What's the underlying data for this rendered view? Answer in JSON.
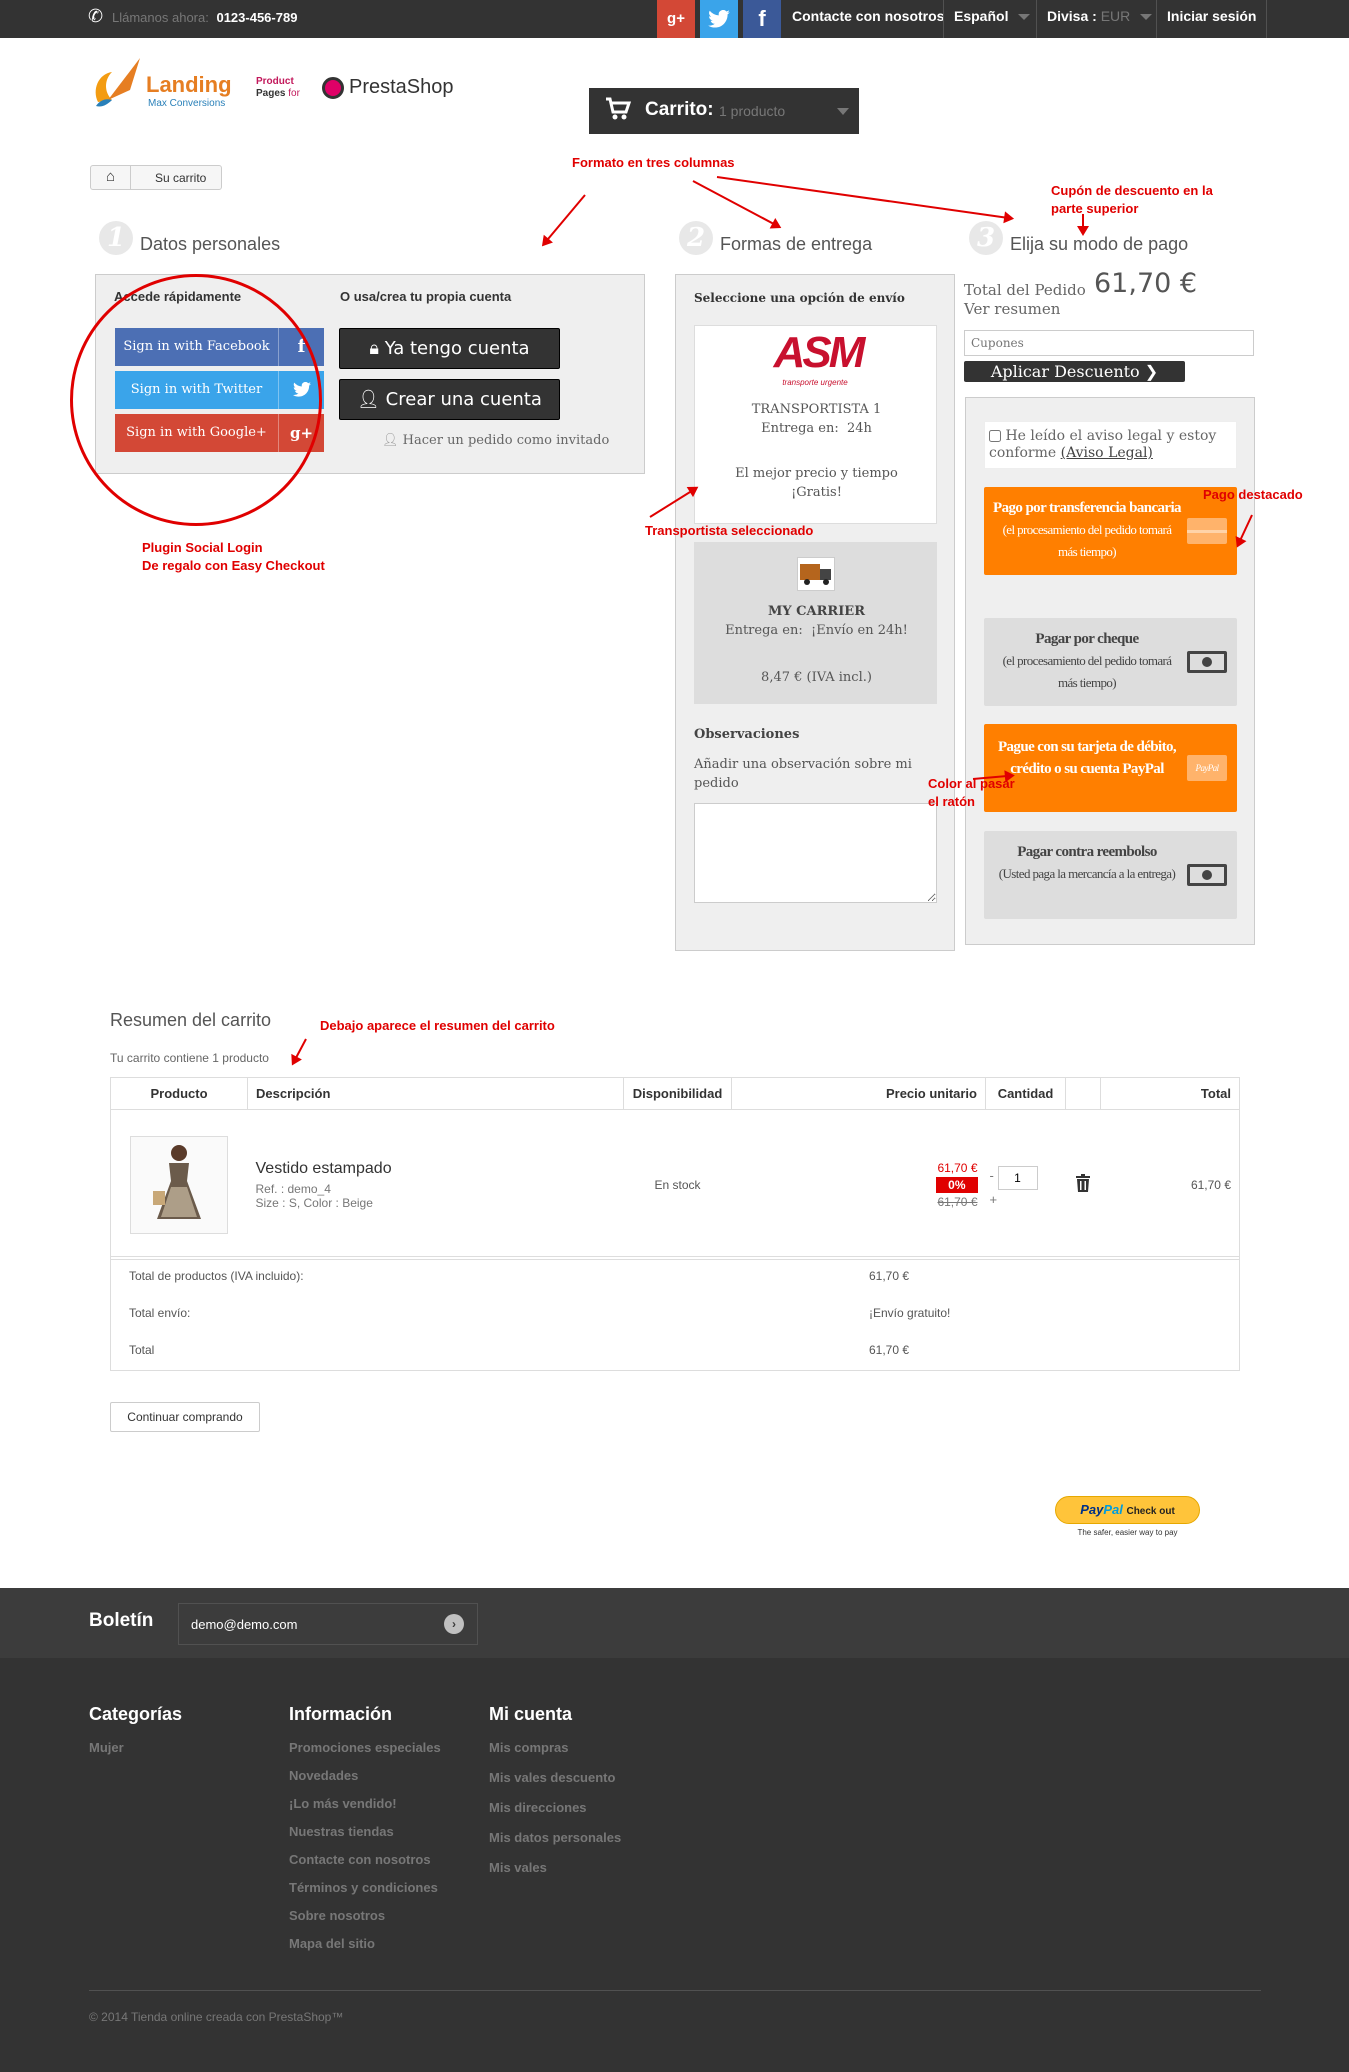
{
  "topbar": {
    "phone_label": "Llámanos ahora:",
    "phone_number": "0123-456-789",
    "social": [
      "g+",
      "t",
      "f"
    ],
    "contact": "Contacte con nosotros",
    "language": "Español",
    "currency_label": "Divisa :",
    "currency_value": "EUR",
    "login": "Iniciar sesión"
  },
  "logo": {
    "landing": "Landing",
    "sub": "Max Conversions",
    "product1": "Product",
    "product2": "Pages",
    "for": "for",
    "presta": "PrestaShop"
  },
  "cart": {
    "label": "Carrito:",
    "count": "1 producto"
  },
  "breadcrumb": {
    "current": "Su carrito"
  },
  "annotations": {
    "three_columns": "Formato en tres columnas",
    "coupon_top1": "Cupón de descuento en la",
    "coupon_top2": "parte superior",
    "social_login1": "Plugin Social Login",
    "social_login2": "De regalo con Easy Checkout",
    "carrier_selected": "Transportista seleccionado",
    "featured_payment": "Pago destacado",
    "hover_color1": "Color al pasar",
    "hover_color2": "el ratón",
    "summary_below": "Debajo aparece el resumen del carrito"
  },
  "step1": {
    "num": "1",
    "title": "Datos personales",
    "quick_access": "Accede rápidamente",
    "own_account": "O usa/crea tu propia cuenta",
    "facebook": "Sign in with Facebook",
    "twitter": "Sign in with Twitter",
    "google": "Sign in with Google+",
    "have_account": "Ya tengo cuenta",
    "create_account": "Crear una cuenta",
    "guest": "Hacer un pedido como invitado"
  },
  "step2": {
    "num": "2",
    "title": "Formas de entrega",
    "select_shipping": "Seleccione una opción de envío",
    "carrier1_logo": "ASM",
    "carrier1_logo_sub": "transporte urgente",
    "carrier1_name": "TRANSPORTISTA 1",
    "carrier1_delivery": "Entrega en:  24h",
    "carrier1_desc1": "El mejor precio y tiempo",
    "carrier1_desc2": "¡Gratis!",
    "carrier2_name": "MY CARRIER",
    "carrier2_delivery": "Entrega en:  ¡Envío en 24h!",
    "carrier2_price": "8,47 € (IVA incl.)",
    "observations_title": "Observaciones",
    "observations_label": "Añadir una observación sobre mi pedido"
  },
  "step3": {
    "num": "3",
    "title": "Elija su modo de pago",
    "total_label": "Total del Pedido",
    "total_value": "61,70 €",
    "view_summary": "Ver resumen",
    "coupon_placeholder": "Cupones",
    "apply_discount": "Aplicar Descuento",
    "terms": "He leído el aviso legal y estoy conforme",
    "terms_link": "(Aviso Legal)",
    "payments": [
      {
        "title": "Pago por transferencia bancaria",
        "note": "(el procesamiento del pedido tomará más tiempo)"
      },
      {
        "title": "Pagar por cheque",
        "note": "(el procesamiento del pedido tomará más tiempo)"
      },
      {
        "title": "Pague con su tarjeta de débito, crédito o su cuenta PayPal",
        "note": ""
      },
      {
        "title": "Pagar contra reembolso",
        "note": "(Usted paga la mercancía a la entrega)"
      }
    ],
    "paypal_badge": "PayPal"
  },
  "summary": {
    "title": "Resumen del carrito",
    "subtitle": "Tu carrito contiene 1 producto",
    "headers": [
      "Producto",
      "Descripción",
      "Disponibilidad",
      "Precio unitario",
      "Cantidad",
      "",
      "Total"
    ],
    "item": {
      "name": "Vestido estampado",
      "ref": "Ref. : demo_4",
      "attrs": "Size : S, Color : Beige",
      "availability": "En stock",
      "price": "61,70 €",
      "discount": "0%",
      "old_price": "61,70 €",
      "qty": "1",
      "minus": "-",
      "plus": "+",
      "total": "61,70 €"
    },
    "totals": [
      {
        "label": "Total de productos (IVA incluido):",
        "value": "61,70 €"
      },
      {
        "label": "Total envío:",
        "value": "¡Envío gratuito!"
      },
      {
        "label": "Total",
        "value": "61,70 €"
      }
    ],
    "continue": "Continuar comprando"
  },
  "paypal": {
    "brand1": "Pay",
    "brand2": "Pal",
    "checkout": "Check out",
    "tagline": "The safer, easier way to pay"
  },
  "footer": {
    "newsletter": "Boletín",
    "newsletter_value": "demo@demo.com",
    "categories_title": "Categorías",
    "categories": [
      "Mujer"
    ],
    "info_title": "Información",
    "info": [
      "Promociones especiales",
      "Novedades",
      "¡Lo más vendido!",
      "Nuestras tiendas",
      "Contacte con nosotros",
      "Términos y condiciones",
      "Sobre nosotros",
      "Mapa del sitio"
    ],
    "account_title": "Mi cuenta",
    "account": [
      "Mis compras",
      "Mis vales descuento",
      "Mis direcciones",
      "Mis datos personales",
      "Mis vales"
    ],
    "copyright": "© 2014 Tienda online creada con PrestaShop™"
  },
  "colors": {
    "orange": "#ff7f00",
    "facebook": "#3b5998",
    "twitter": "#3aa4ea",
    "google": "#d34836",
    "dark": "#333333",
    "annotation": "#e00000"
  }
}
